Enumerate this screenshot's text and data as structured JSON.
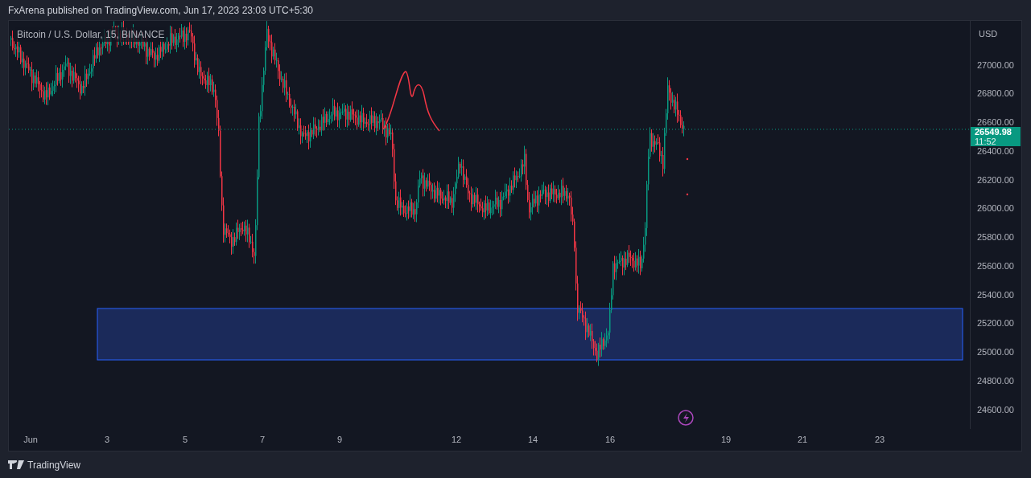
{
  "header": {
    "text": "FxArena published on TradingView.com, Jun 17, 2023 23:03 UTC+5:30"
  },
  "legend": {
    "text": "Bitcoin / U.S. Dollar, 15, BINANCE"
  },
  "price_axis": {
    "currency": "USD",
    "ticks": [
      "27000.00",
      "26800.00",
      "26600.00",
      "26400.00",
      "26200.00",
      "26000.00",
      "25800.00",
      "25600.00",
      "25400.00",
      "25200.00",
      "25000.00",
      "24800.00",
      "24600.00"
    ]
  },
  "last_price": {
    "value": "26549.98",
    "countdown": "11:52"
  },
  "time_axis": {
    "labels": [
      "Jun",
      "3",
      "5",
      "7",
      "9",
      "12",
      "14",
      "16",
      "19",
      "21",
      "23"
    ]
  },
  "footer": {
    "brand": "TradingView"
  }
}
